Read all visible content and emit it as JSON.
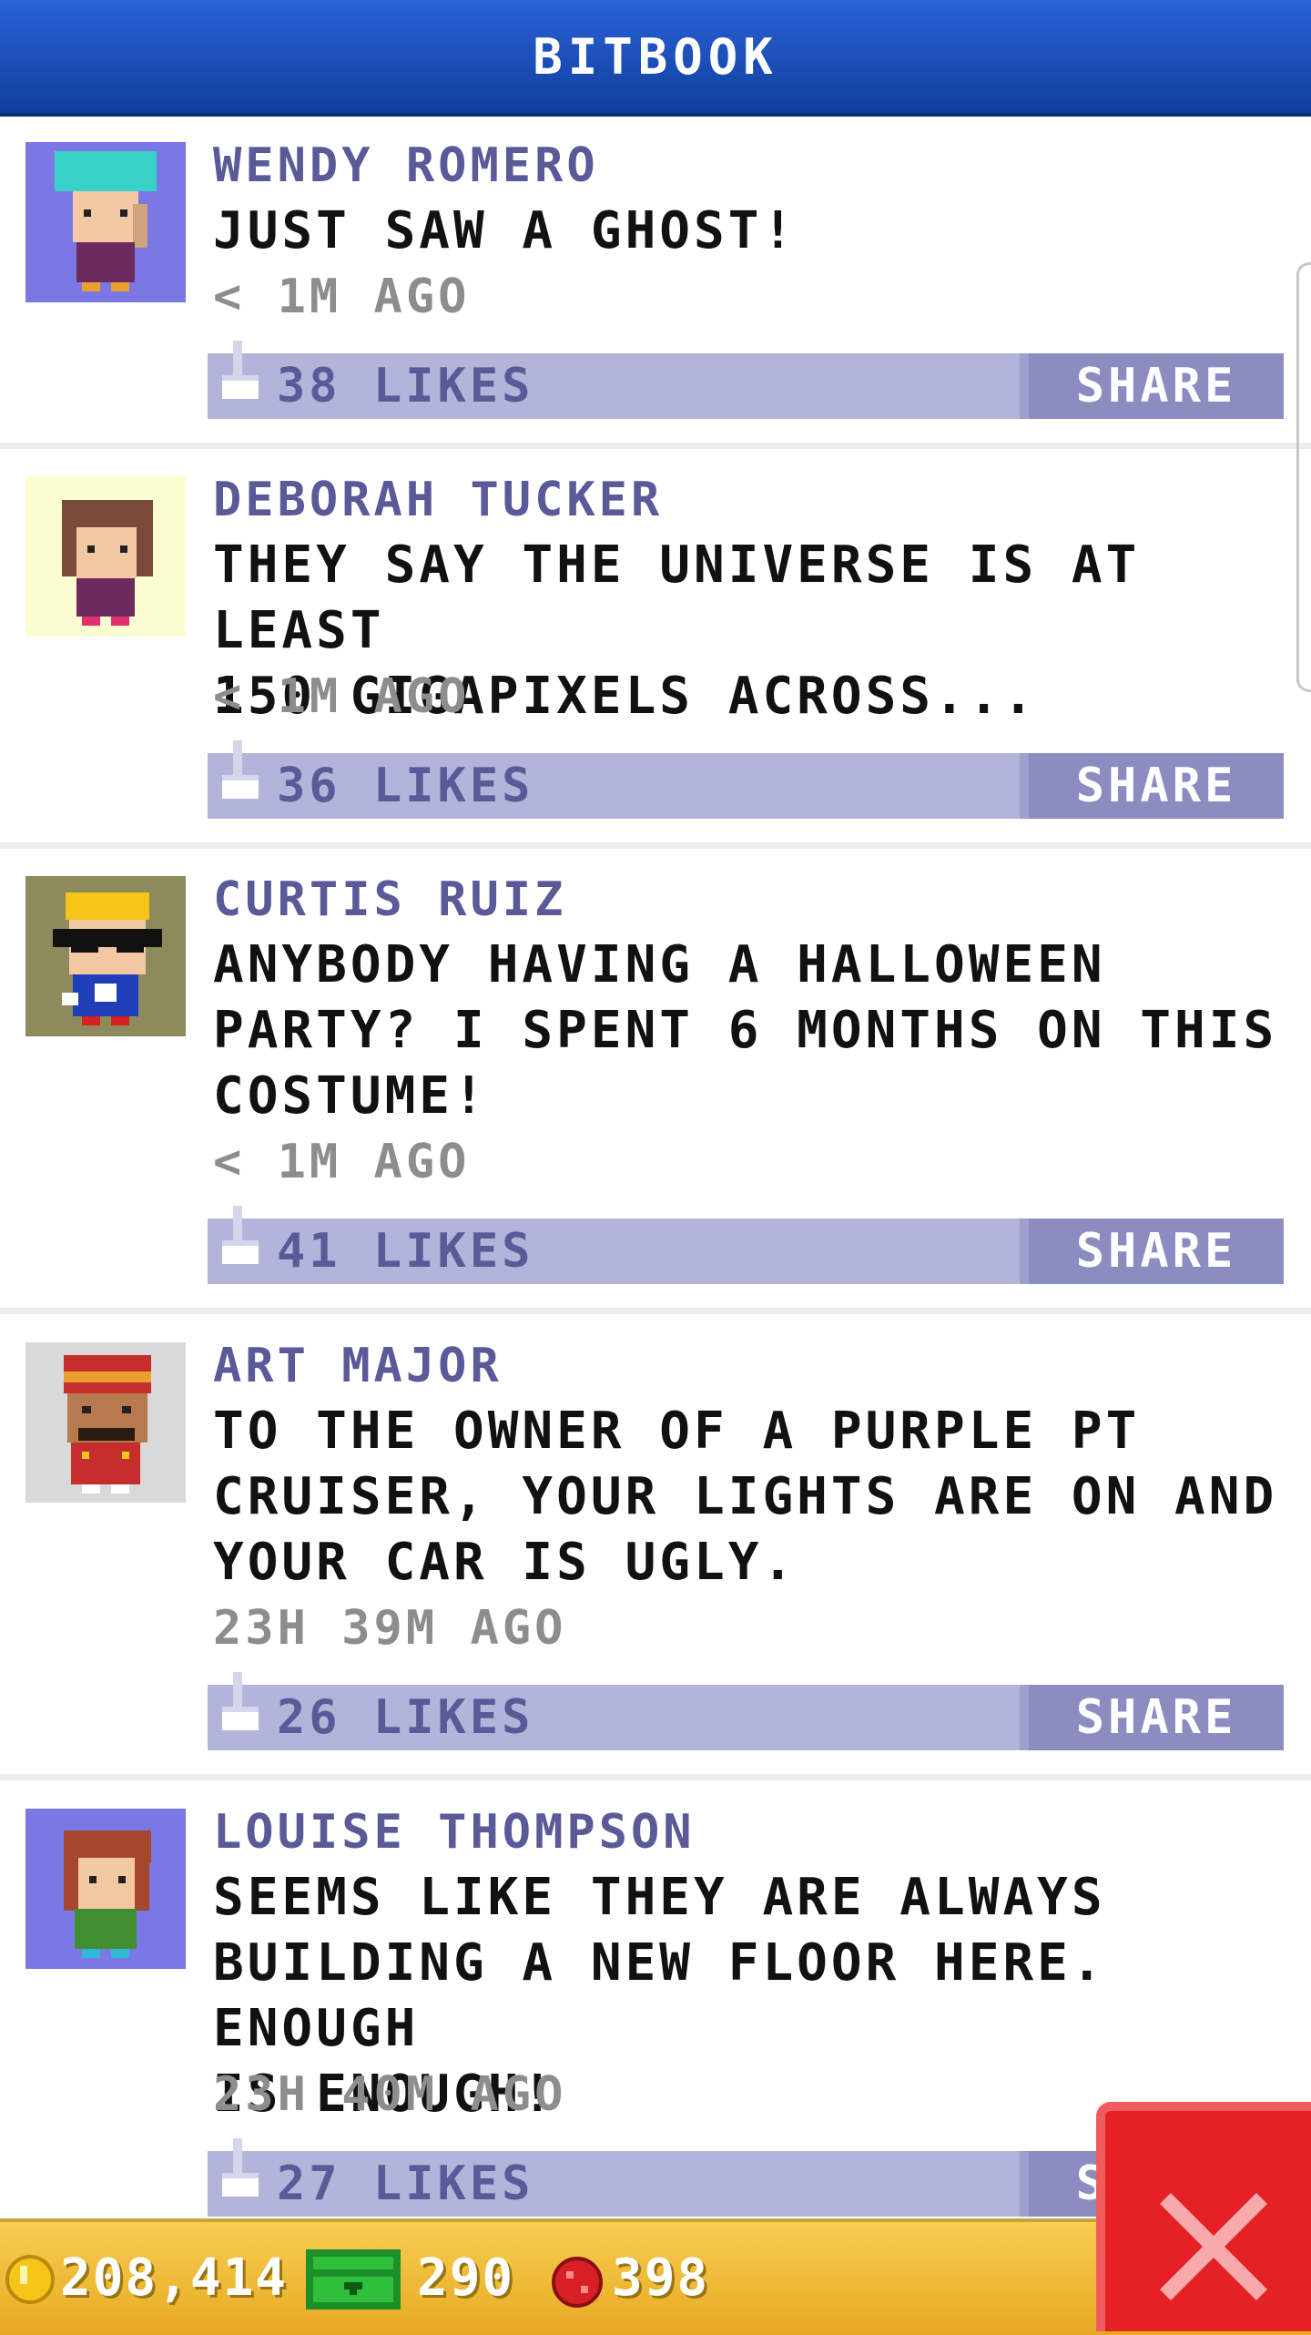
{
  "header": {
    "title": "BITBOOK"
  },
  "posts": [
    {
      "author": "WENDY ROMERO",
      "message": "JUST SAW A GHOST!",
      "time": "< 1M AGO",
      "likes": "38 LIKES",
      "share": "SHARE",
      "avatar_bg": "#7b78e6"
    },
    {
      "author": "DEBORAH TUCKER",
      "message": "THEY SAY THE UNIVERSE IS AT LEAST\n150 GIGAPIXELS ACROSS...",
      "time": "< 1M AGO",
      "likes": "36 LIKES",
      "share": "SHARE",
      "avatar_bg": "#fdfdd2"
    },
    {
      "author": "CURTIS RUIZ",
      "message": "ANYBODY HAVING A HALLOWEEN\nPARTY? I SPENT 6 MONTHS ON THIS\nCOSTUME!",
      "time": "< 1M AGO",
      "likes": "41 LIKES",
      "share": "SHARE",
      "avatar_bg": "#8d8a5b"
    },
    {
      "author": "ART MAJOR",
      "message": "TO THE OWNER OF A PURPLE PT\nCRUISER, YOUR LIGHTS ARE ON AND\nYOUR CAR IS UGLY.",
      "time": "23H 39M AGO",
      "likes": "26 LIKES",
      "share": "SHARE",
      "avatar_bg": "#d9d9d9"
    },
    {
      "author": "LOUISE THOMPSON",
      "message": "SEEMS LIKE THEY ARE ALWAYS\nBUILDING A NEW FLOOR HERE. ENOUGH\nIS ENOUGH!",
      "time": "23H 40M AGO",
      "likes": "27 LIKES",
      "share": "SHARE",
      "avatar_bg": "#7b78e6"
    }
  ],
  "status": {
    "coins": "208,414",
    "bux": "290",
    "gems": "398"
  },
  "colors": {
    "header": "#1e50bf",
    "bar": "#b2b5d9",
    "share": "#8b8dc0",
    "close": "#e52125",
    "status": "#f0be3c"
  }
}
